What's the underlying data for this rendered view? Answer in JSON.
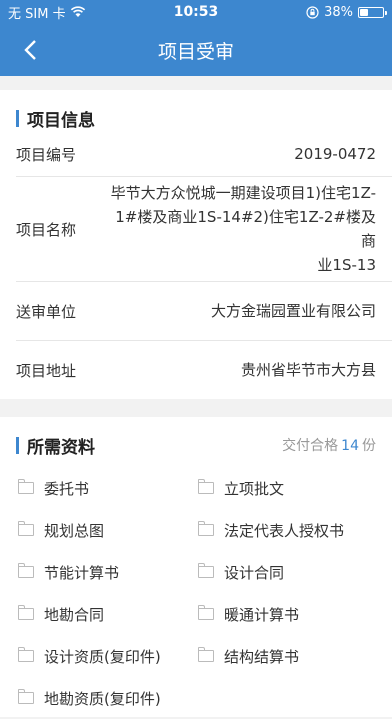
{
  "status": {
    "carrier": "无 SIM 卡",
    "time": "10:53",
    "battery": "38%",
    "battery_level": 0.38
  },
  "nav": {
    "title": "项目受审"
  },
  "project_info": {
    "title": "项目信息",
    "rows": [
      {
        "label": "项目编号",
        "value": "2019-0472"
      },
      {
        "label": "项目名称",
        "value_lines": [
          "毕节大方众悦城一期建设项目1)住宅1Z-",
          "1#楼及商业1S-14#2)住宅1Z-2#楼及商",
          "业1S-13"
        ]
      },
      {
        "label": "送审单位",
        "value": "大方金瑞园置业有限公司"
      },
      {
        "label": "项目地址",
        "value": "贵州省毕节市大方县"
      }
    ]
  },
  "materials": {
    "title": "所需资料",
    "summary_prefix": "交付合格",
    "summary_count": "14",
    "summary_suffix": "份",
    "items": [
      "委托书",
      "立项批文",
      "规划总图",
      "法定代表人授权书",
      "节能计算书",
      "设计合同",
      "地勘合同",
      "暖通计算书",
      "设计资质(复印件)",
      "结构结算书",
      "地勘资质(复印件)"
    ]
  }
}
